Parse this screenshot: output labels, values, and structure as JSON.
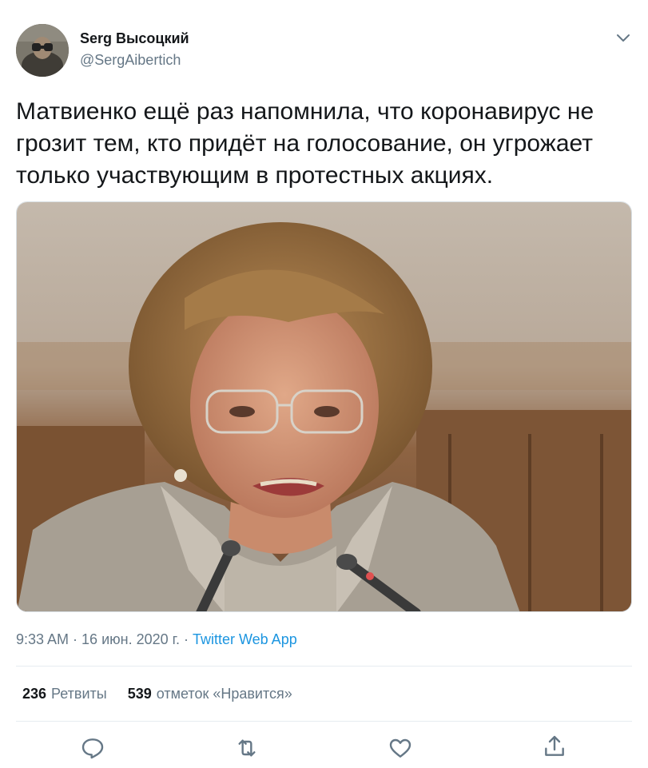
{
  "author": {
    "name": "Serg Высоцкий",
    "handle": "@SergAibertich",
    "avatar_icon": "avatar-binoculars-photo"
  },
  "tweet": {
    "text": "Матвиенко ещё раз напомнила, что коронавирус не грозит тем, кто придёт на голосование, он угрожает только участвующим в протестных акциях.",
    "media_description_icon": "photo"
  },
  "meta": {
    "time": "9:33 AM",
    "separator": " · ",
    "date": "16 июн. 2020 г.",
    "source": "Twitter Web App"
  },
  "stats": {
    "retweets_count": "236",
    "retweets_label": "Ретвиты",
    "likes_count": "539",
    "likes_label": "отметок «Нравится»"
  },
  "actions": {
    "reply_icon": "reply-icon",
    "retweet_icon": "retweet-icon",
    "like_icon": "heart-icon",
    "share_icon": "share-icon"
  },
  "colors": {
    "text": "#14171a",
    "secondary": "#657786",
    "link": "#1b95e0",
    "divider": "#e6ecf0"
  }
}
